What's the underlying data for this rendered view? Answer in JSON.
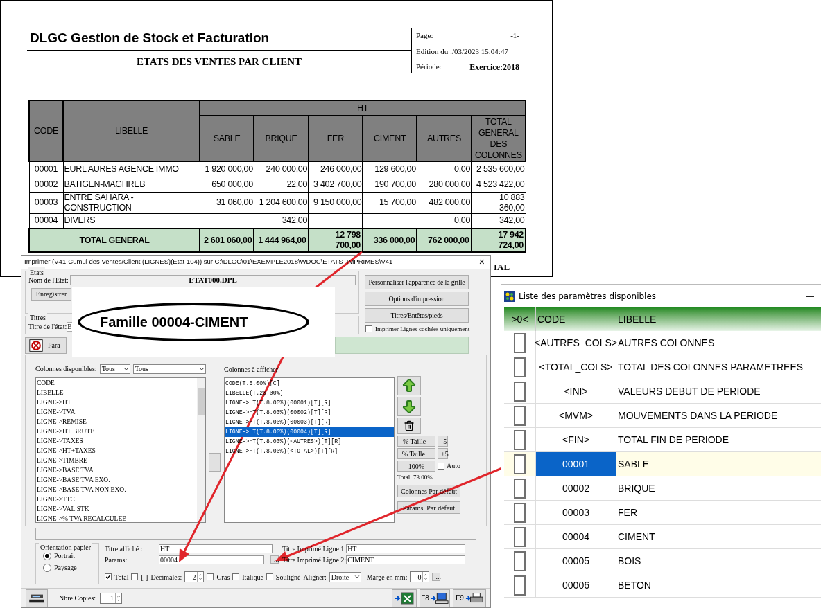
{
  "report": {
    "title": "DLGC Gestion de Stock et Facturation",
    "subtitle": "ETATS DES VENTES PAR CLIENT",
    "meta": [
      {
        "label": "Page:",
        "value": "-1-"
      },
      {
        "label": "Edition du :/03/2023 15:04:47"
      },
      {
        "label": "Période:",
        "value": "Exercice:2018"
      }
    ],
    "group_header": "HT",
    "columns": [
      "CODE",
      "LIBELLE",
      "SABLE",
      "BRIQUE",
      "FER",
      "CIMENT",
      "AUTRES",
      "TOTAL GENERAL DES COLONNES"
    ],
    "rows": [
      [
        "00001",
        "EURL AURES AGENCE IMMO",
        "1 920 000,00",
        "240 000,00",
        "246 000,00",
        "129 600,00",
        "0,00",
        "2 535 600,00"
      ],
      [
        "00002",
        "BATIGEN-MAGHREB",
        "650 000,00",
        "22,00",
        "3 402 700,00",
        "190 700,00",
        "280 000,00",
        "4 523 422,00"
      ],
      [
        "00003",
        "ENTRE SAHARA - CONSTRUCTION",
        "31 060,00",
        "1 204 600,00",
        "9 150 000,00",
        "15 700,00",
        "482 000,00",
        "10 883 360,00"
      ],
      [
        "00004",
        "DIVERS",
        "",
        "342,00",
        "",
        "",
        "0,00",
        "342,00"
      ]
    ],
    "total_row": [
      "TOTAL GENERAL",
      "2 601 060,00",
      "1 444 964,00",
      "12 798 700,00",
      "336 000,00",
      "762 000,00",
      "17 942 724,00"
    ],
    "footer_fragment": "IAL"
  },
  "dialog": {
    "title": "Imprimer (V41-Cumul des Ventes/Client (LIGNES)(Etat 104))  sur C:\\DLGC\\01\\EXEMPLE2018\\WDOC\\ETATS_IMPRIMES\\V41",
    "close": "×",
    "etats": {
      "legend": "Etats",
      "name_label": "Nom de l'Etat:",
      "name_value": "ETAT000.DPL",
      "save_button": "Enregistrer"
    },
    "titres": {
      "legend": "Titres",
      "label": "Titre de l'état:",
      "value": "E"
    },
    "params_button": "Para",
    "side_buttons": [
      "Personnaliser l'apparence de la grille",
      "Options d'impression",
      "Titres/Entêtes/pieds"
    ],
    "print_checked_only": {
      "label": "Imprimer Lignes cochées uniquement",
      "checked": false
    },
    "available": {
      "label": "Colonnes disponibles:",
      "filter_1": "Tous",
      "filter_2": "Tous",
      "items": [
        "CODE",
        "LIBELLE",
        "LIGNE->HT",
        "LIGNE->TVA",
        "LIGNE->REMISE",
        "LIGNE->HT BRUTE",
        "LIGNE->TAXES",
        "LIGNE->HT+TAXES",
        "LIGNE->TIMBRE",
        "LIGNE->BASE TVA",
        "LIGNE->BASE TVA EXO.",
        "LIGNE->BASE TVA NON.EXO.",
        "LIGNE->TTC",
        "LIGNE->VAL.STK",
        "LIGNE->% TVA RECALCULEE"
      ]
    },
    "shown": {
      "label": "Colonnes à afficher",
      "items": [
        {
          "text": "CODE(T.5.00%)[C]",
          "selected": false
        },
        {
          "text": "LIBELLE(T.20.00%)",
          "selected": false
        },
        {
          "text": "LIGNE->HT(T.8.00%)(00001)[T][R]",
          "selected": false
        },
        {
          "text": "LIGNE->HT(T.8.00%)(00002)[T][R]",
          "selected": false
        },
        {
          "text": "LIGNE->HT(T.8.00%)(00003)[T][R]",
          "selected": false
        },
        {
          "text": "LIGNE->HT(T.8.00%)(00004)[T][R]",
          "selected": true
        },
        {
          "text": "LIGNE->HT(T.8.00%)(<AUTRES>)[T][R]",
          "selected": false
        },
        {
          "text": "LIGNE->HT(T.8.00%)(<TOTAL>)[T][R]",
          "selected": false
        }
      ]
    },
    "size_minus": "% Taille -",
    "minus_step": "-5",
    "size_plus": "% Taille +",
    "plus_step": "+5",
    "reset": "100%",
    "auto": {
      "label": "Auto",
      "checked": false
    },
    "total": "Total:  73.00%",
    "default_columns": "Colonnes Par défaut",
    "default_params": "Params. Par défaut",
    "orientation": {
      "legend": "Orientation papier",
      "options": [
        {
          "label": "Portrait",
          "selected": true
        },
        {
          "label": "Paysage",
          "selected": false
        }
      ]
    },
    "title_shown": {
      "label": "Titre affiché :",
      "value": "HT"
    },
    "params": {
      "label": "Params:",
      "value": "00004",
      "more": "..."
    },
    "line_1": {
      "label": "Titre Imprimé Ligne 1:",
      "value": "HT"
    },
    "line_2": {
      "label": "Titre Imprimé Ligne 2:",
      "value": "CIMENT"
    },
    "total_check": {
      "label": "Total",
      "checked": true
    },
    "minus_check": {
      "label": "[-]",
      "checked": false
    },
    "decimals": {
      "label": "Décimales:",
      "value": "2"
    },
    "styles": [
      {
        "label": "Gras",
        "checked": false
      },
      {
        "label": "Italique",
        "checked": false
      },
      {
        "label": "Souligné",
        "checked": false
      }
    ],
    "align": {
      "label": "Aligner:",
      "value": "Droite"
    },
    "margin": {
      "label": "Marge en mm:",
      "value": "0",
      "more": "..."
    },
    "copies": {
      "label": "Nbre Copies:",
      "value": "1"
    },
    "f8": "F8",
    "f9": "F9"
  },
  "callout": "Famille 00004-CIMENT",
  "param_window": {
    "title": "Liste des paramètres disponibles",
    "minimize": "—",
    "columns": [
      ">0<",
      "CODE",
      "LIBELLE"
    ],
    "rows": [
      {
        "code": "<AUTRES_COLS>",
        "label": "AUTRES COLONNES",
        "checked": false,
        "selected": false
      },
      {
        "code": "<TOTAL_COLS>",
        "label": "TOTAL DES COLONNES PARAMETREES",
        "checked": false,
        "selected": false
      },
      {
        "code": "<INI>",
        "label": "VALEURS DEBUT DE PERIODE",
        "checked": false,
        "selected": false
      },
      {
        "code": "<MVM>",
        "label": "MOUVEMENTS DANS LA PERIODE",
        "checked": false,
        "selected": false
      },
      {
        "code": "<FIN>",
        "label": "TOTAL FIN DE PERIODE",
        "checked": false,
        "selected": false
      },
      {
        "code": "00001",
        "label": "SABLE",
        "checked": false,
        "selected": true
      },
      {
        "code": "00002",
        "label": "BRIQUE",
        "checked": false,
        "selected": false
      },
      {
        "code": "00003",
        "label": "FER",
        "checked": false,
        "selected": false
      },
      {
        "code": "00004",
        "label": "CIMENT",
        "checked": false,
        "selected": false
      },
      {
        "code": "00005",
        "label": "BOIS",
        "checked": false,
        "selected": false
      },
      {
        "code": "00006",
        "label": "BETON",
        "checked": false,
        "selected": false
      }
    ]
  }
}
